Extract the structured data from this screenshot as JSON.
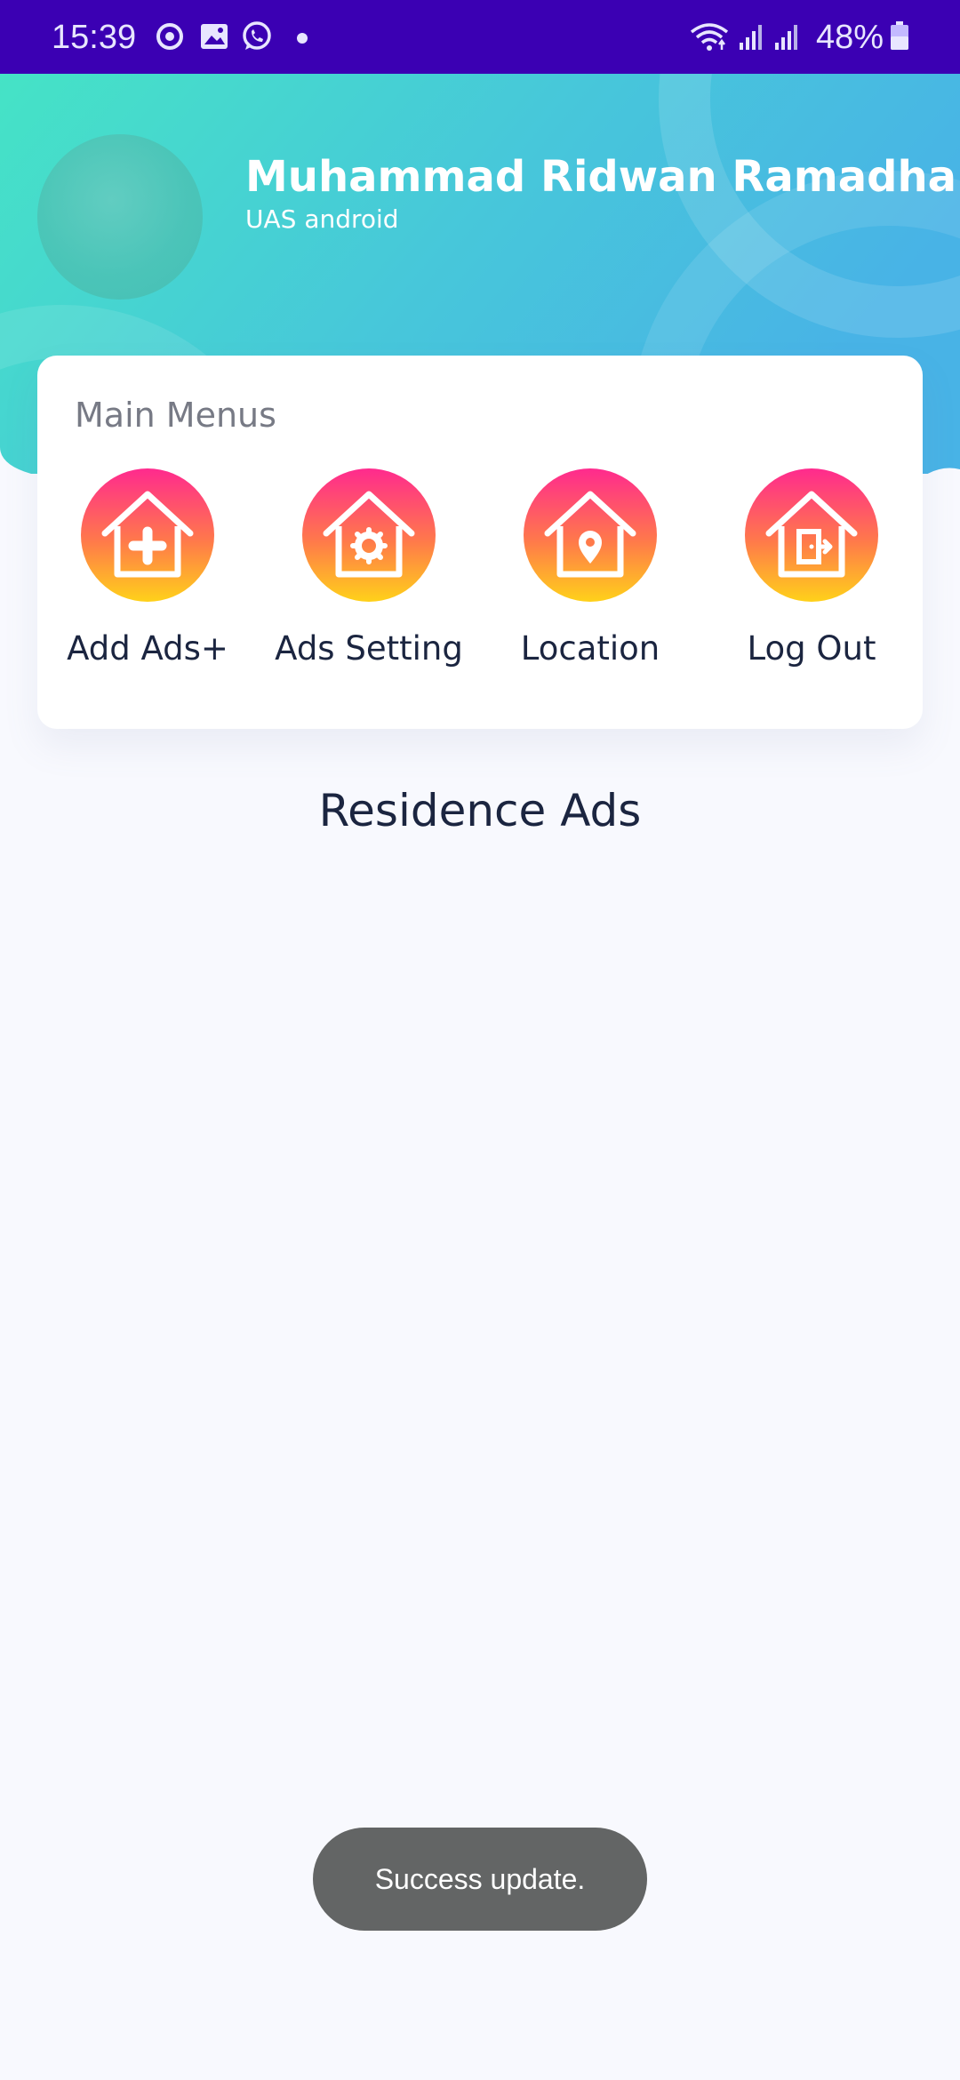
{
  "status_bar": {
    "time": "15:39",
    "battery": "48%",
    "icons": [
      "sync-icon",
      "gallery-icon",
      "whatsapp-icon",
      "notification-dot",
      "wifi-icon",
      "signal-icon",
      "signal-icon",
      "battery-icon"
    ]
  },
  "profile": {
    "name": "Muhammad Ridwan Ramadhan",
    "subtitle": "UAS android"
  },
  "menu": {
    "title": "Main Menus",
    "items": [
      {
        "label": "Add Ads+",
        "icon": "house-plus-icon"
      },
      {
        "label": "Ads Setting",
        "icon": "house-gear-icon"
      },
      {
        "label": "Location",
        "icon": "house-location-icon"
      },
      {
        "label": "Log Out",
        "icon": "house-exit-icon"
      }
    ]
  },
  "section": {
    "title": "Residence Ads"
  },
  "toast": {
    "message": "Success update."
  },
  "colors": {
    "status_bar": "#3b00b3",
    "header_start": "#45e3c6",
    "header_end": "#48b3e6",
    "icon_gradient_top": "#ff2a8e",
    "icon_gradient_bottom": "#ffd11a",
    "text_dark": "#1b2540"
  }
}
